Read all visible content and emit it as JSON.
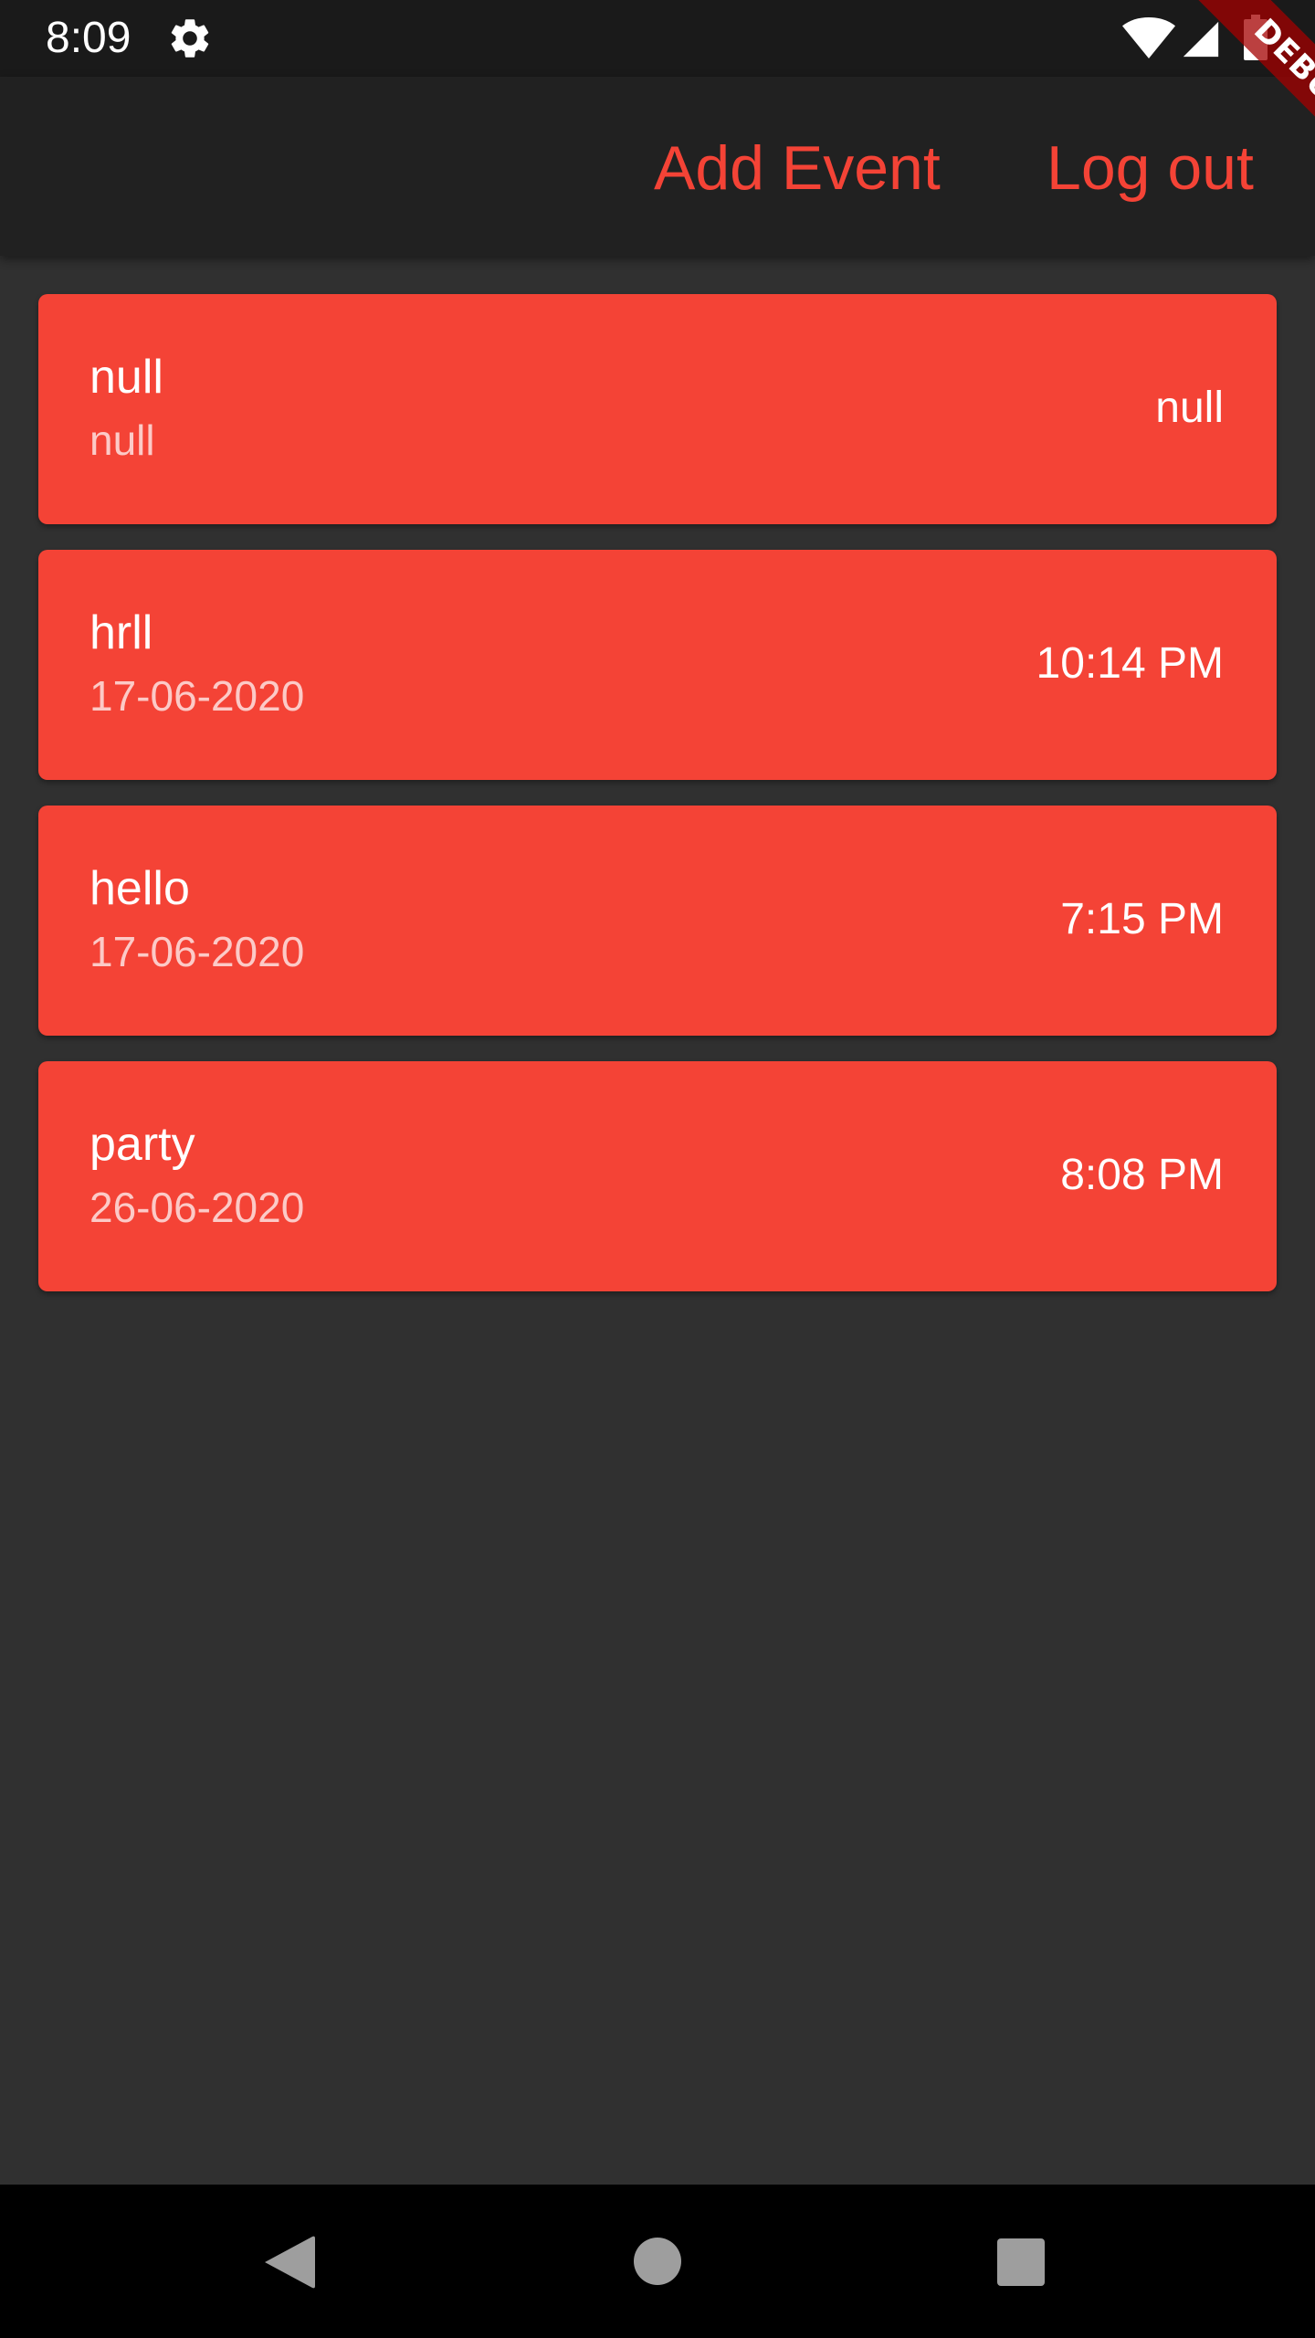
{
  "status_bar": {
    "time": "8:09",
    "icons": [
      "gear-icon",
      "wifi-icon",
      "signal-icon",
      "battery-icon"
    ]
  },
  "debug_banner": {
    "label": "DEBUG"
  },
  "app_bar": {
    "actions": [
      {
        "label": "Add Event"
      },
      {
        "label": "Log out"
      }
    ]
  },
  "events": [
    {
      "title": "null",
      "subtitle": "null",
      "time": "null"
    },
    {
      "title": "hrll",
      "subtitle": "17-06-2020",
      "time": "10:14 PM"
    },
    {
      "title": "hello",
      "subtitle": "17-06-2020",
      "time": "7:15 PM"
    },
    {
      "title": "party",
      "subtitle": "26-06-2020",
      "time": "8:08 PM"
    }
  ],
  "nav_bar": {
    "icons": [
      "back-icon",
      "home-icon",
      "recents-icon"
    ]
  },
  "colors": {
    "accent": "#f44336",
    "background": "#303030",
    "app_bar": "#212121",
    "status_bar": "#1a1a1a",
    "nav_bar": "#000000",
    "debug_banner": "#a40000"
  }
}
